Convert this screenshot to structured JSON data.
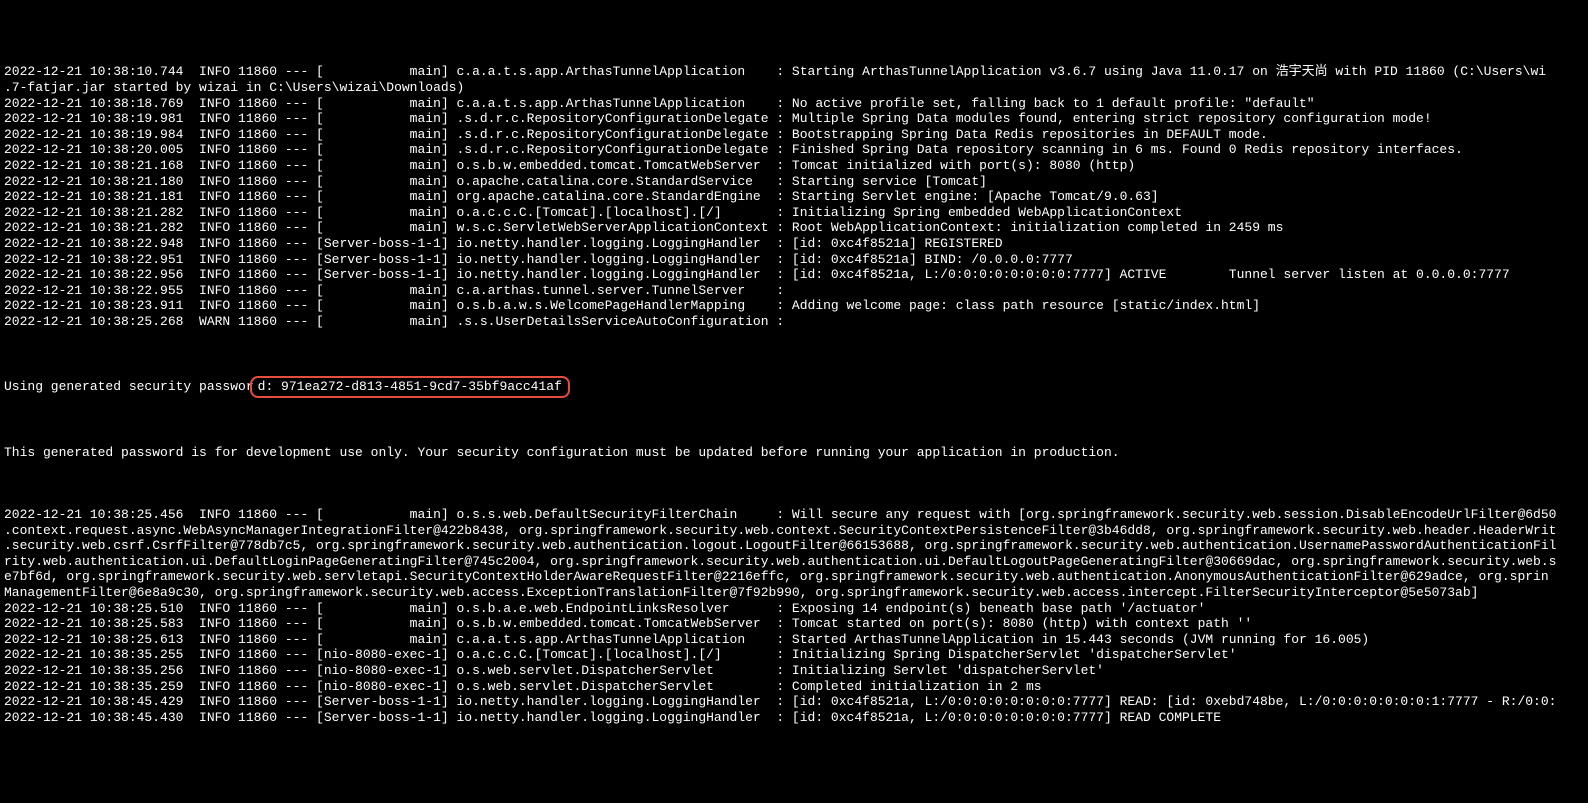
{
  "log_lines": [
    "2022-12-21 10:38:10.744  INFO 11860 --- [           main] c.a.a.t.s.app.ArthasTunnelApplication    : Starting ArthasTunnelApplication v3.6.7 using Java 11.0.17 on 浩宇天尚 with PID 11860 (C:\\Users\\wi",
    ".7-fatjar.jar started by wizai in C:\\Users\\wizai\\Downloads)",
    "2022-12-21 10:38:18.769  INFO 11860 --- [           main] c.a.a.t.s.app.ArthasTunnelApplication    : No active profile set, falling back to 1 default profile: \"default\"",
    "2022-12-21 10:38:19.981  INFO 11860 --- [           main] .s.d.r.c.RepositoryConfigurationDelegate : Multiple Spring Data modules found, entering strict repository configuration mode!",
    "2022-12-21 10:38:19.984  INFO 11860 --- [           main] .s.d.r.c.RepositoryConfigurationDelegate : Bootstrapping Spring Data Redis repositories in DEFAULT mode.",
    "2022-12-21 10:38:20.005  INFO 11860 --- [           main] .s.d.r.c.RepositoryConfigurationDelegate : Finished Spring Data repository scanning in 6 ms. Found 0 Redis repository interfaces.",
    "2022-12-21 10:38:21.168  INFO 11860 --- [           main] o.s.b.w.embedded.tomcat.TomcatWebServer  : Tomcat initialized with port(s): 8080 (http)",
    "2022-12-21 10:38:21.180  INFO 11860 --- [           main] o.apache.catalina.core.StandardService   : Starting service [Tomcat]",
    "2022-12-21 10:38:21.181  INFO 11860 --- [           main] org.apache.catalina.core.StandardEngine  : Starting Servlet engine: [Apache Tomcat/9.0.63]",
    "2022-12-21 10:38:21.282  INFO 11860 --- [           main] o.a.c.c.C.[Tomcat].[localhost].[/]       : Initializing Spring embedded WebApplicationContext",
    "2022-12-21 10:38:21.282  INFO 11860 --- [           main] w.s.c.ServletWebServerApplicationContext : Root WebApplicationContext: initialization completed in 2459 ms",
    "2022-12-21 10:38:22.948  INFO 11860 --- [Server-boss-1-1] io.netty.handler.logging.LoggingHandler  : [id: 0xc4f8521a] REGISTERED",
    "2022-12-21 10:38:22.951  INFO 11860 --- [Server-boss-1-1] io.netty.handler.logging.LoggingHandler  : [id: 0xc4f8521a] BIND: /0.0.0.0:7777",
    "2022-12-21 10:38:22.956  INFO 11860 --- [Server-boss-1-1] io.netty.handler.logging.LoggingHandler  : [id: 0xc4f8521a, L:/0:0:0:0:0:0:0:0:7777] ACTIVE        Tunnel server listen at 0.0.0.0:7777",
    "2022-12-21 10:38:22.955  INFO 11860 --- [           main] c.a.arthas.tunnel.server.TunnelServer    :",
    "2022-12-21 10:38:23.911  INFO 11860 --- [           main] o.s.b.a.w.s.WelcomePageHandlerMapping    : Adding welcome page: class path resource [static/index.html]",
    "2022-12-21 10:38:25.268  WARN 11860 --- [           main] .s.s.UserDetailsServiceAutoConfiguration :"
  ],
  "password_prefix": "Using generated security passwor",
  "password_highlighted": "d: 971ea272-d813-4851-9cd7-35bf9acc41af",
  "dev_warning": "This generated password is for development use only. Your security configuration must be updated before running your application in production.",
  "log_lines_after": [
    "2022-12-21 10:38:25.456  INFO 11860 --- [           main] o.s.s.web.DefaultSecurityFilterChain     : Will secure any request with [org.springframework.security.web.session.DisableEncodeUrlFilter@6d50",
    ".context.request.async.WebAsyncManagerIntegrationFilter@422b8438, org.springframework.security.web.context.SecurityContextPersistenceFilter@3b46dd8, org.springframework.security.web.header.HeaderWrit",
    ".security.web.csrf.CsrfFilter@778db7c5, org.springframework.security.web.authentication.logout.LogoutFilter@66153688, org.springframework.security.web.authentication.UsernamePasswordAuthenticationFil",
    "rity.web.authentication.ui.DefaultLoginPageGeneratingFilter@745c2004, org.springframework.security.web.authentication.ui.DefaultLogoutPageGeneratingFilter@30669dac, org.springframework.security.web.s",
    "e7bf6d, org.springframework.security.web.servletapi.SecurityContextHolderAwareRequestFilter@2216effc, org.springframework.security.web.authentication.AnonymousAuthenticationFilter@629adce, org.sprin",
    "ManagementFilter@6e8a9c30, org.springframework.security.web.access.ExceptionTranslationFilter@7f92b990, org.springframework.security.web.access.intercept.FilterSecurityInterceptor@5e5073ab]",
    "2022-12-21 10:38:25.510  INFO 11860 --- [           main] o.s.b.a.e.web.EndpointLinksResolver      : Exposing 14 endpoint(s) beneath base path '/actuator'",
    "2022-12-21 10:38:25.583  INFO 11860 --- [           main] o.s.b.w.embedded.tomcat.TomcatWebServer  : Tomcat started on port(s): 8080 (http) with context path ''",
    "2022-12-21 10:38:25.613  INFO 11860 --- [           main] c.a.a.t.s.app.ArthasTunnelApplication    : Started ArthasTunnelApplication in 15.443 seconds (JVM running for 16.005)",
    "2022-12-21 10:38:35.255  INFO 11860 --- [nio-8080-exec-1] o.a.c.c.C.[Tomcat].[localhost].[/]       : Initializing Spring DispatcherServlet 'dispatcherServlet'",
    "2022-12-21 10:38:35.256  INFO 11860 --- [nio-8080-exec-1] o.s.web.servlet.DispatcherServlet        : Initializing Servlet 'dispatcherServlet'",
    "2022-12-21 10:38:35.259  INFO 11860 --- [nio-8080-exec-1] o.s.web.servlet.DispatcherServlet        : Completed initialization in 2 ms",
    "2022-12-21 10:38:45.429  INFO 11860 --- [Server-boss-1-1] io.netty.handler.logging.LoggingHandler  : [id: 0xc4f8521a, L:/0:0:0:0:0:0:0:0:7777] READ: [id: 0xebd748be, L:/0:0:0:0:0:0:0:1:7777 - R:/0:0:",
    "2022-12-21 10:38:45.430  INFO 11860 --- [Server-boss-1-1] io.netty.handler.logging.LoggingHandler  : [id: 0xc4f8521a, L:/0:0:0:0:0:0:0:0:7777] READ COMPLETE"
  ]
}
